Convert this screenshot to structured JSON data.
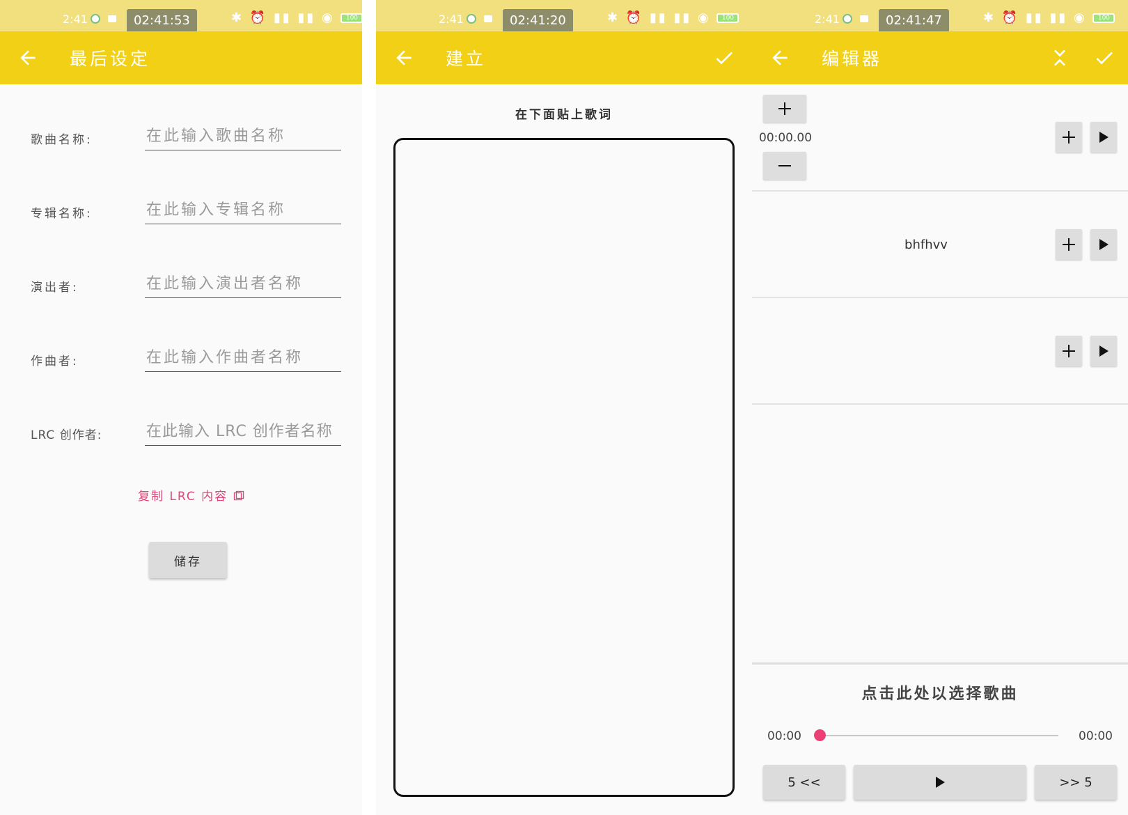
{
  "panel1": {
    "status": {
      "time_small": "2:41",
      "clock": "02:41:53",
      "battery": "100"
    },
    "appbar": {
      "title": "最后设定",
      "back_icon": "arrow-back-icon"
    },
    "form": {
      "song_name": {
        "label": "歌曲名称:",
        "placeholder": "在此输入歌曲名称"
      },
      "album_name": {
        "label": "专辑名称:",
        "placeholder": "在此输入专辑名称"
      },
      "performer": {
        "label": "演出者:",
        "placeholder": "在此输入演出者名称"
      },
      "composer": {
        "label": "作曲者:",
        "placeholder": "在此输入作曲者名称"
      },
      "lrc_author": {
        "label": "LRC 创作者:",
        "placeholder": "在此输入 LRC 创作者名称"
      }
    },
    "copy_link": "复制 LRC 内容",
    "save_label": "储存"
  },
  "panel2": {
    "status": {
      "time_small": "2:41",
      "clock": "02:41:20",
      "battery": "100"
    },
    "appbar": {
      "title": "建立",
      "back_icon": "arrow-back-icon",
      "action_icon": "check-icon"
    },
    "paste_hint": "在下面贴上歌词",
    "lyrics_value": ""
  },
  "panel3": {
    "status": {
      "time_small": "2:41",
      "clock": "02:41:47",
      "battery": "100"
    },
    "appbar": {
      "title": "编辑器",
      "back_icon": "arrow-back-icon",
      "collapse_icon": "collapse-icon",
      "action_icon": "check-icon"
    },
    "timestamp": "00:00.00",
    "lines": [
      "",
      "bhfhvv",
      ""
    ],
    "select_song": "点击此处以选择歌曲",
    "player": {
      "current": "00:00",
      "total": "00:00",
      "progress": 0,
      "rewind": "5 <<",
      "forward": ">> 5"
    },
    "colors": {
      "accent": "#ee3f74",
      "appbar": "#f2d016",
      "statusbar": "#f2e07f",
      "link": "#e0457b"
    }
  }
}
